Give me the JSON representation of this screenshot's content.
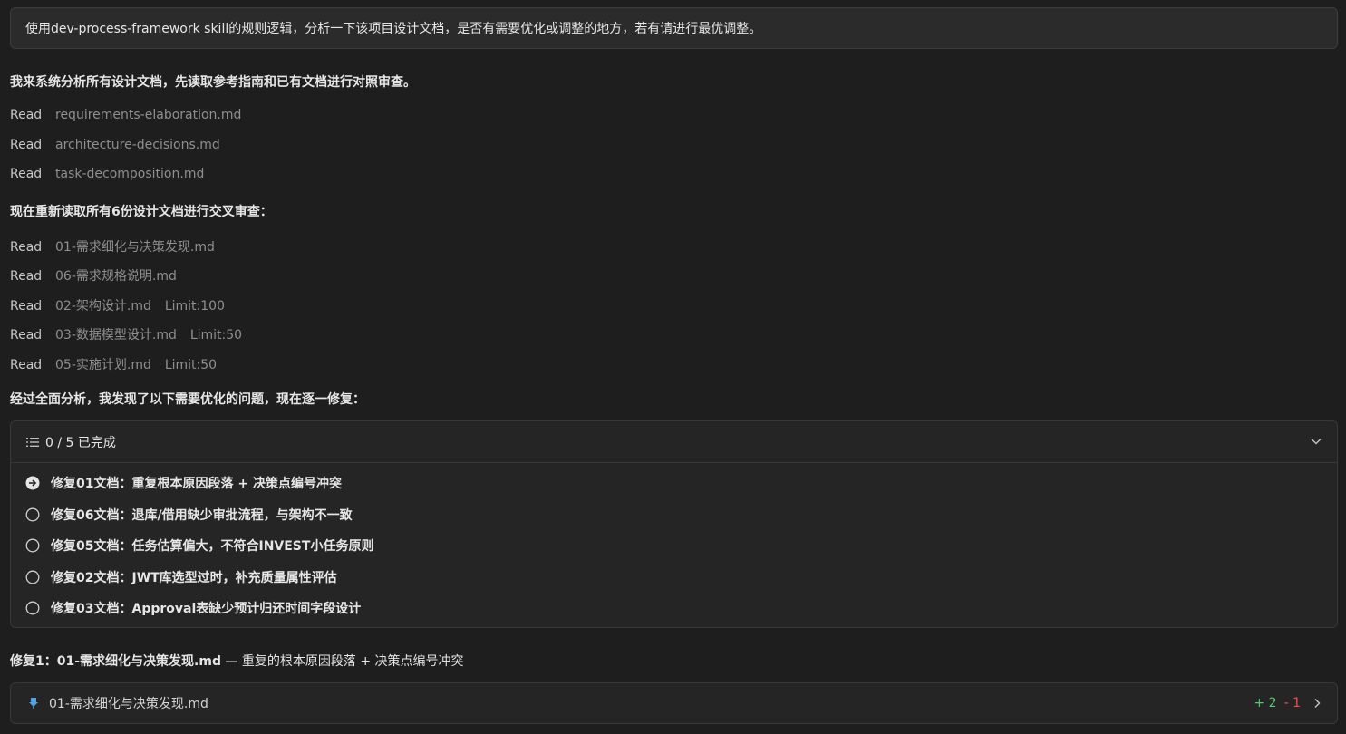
{
  "user_message": "使用dev-process-framework skill的规则逻辑，分析一下该项目设计文档，是否有需要优化或调整的地方，若有请进行最优调整。",
  "intro_heading": "我来系统分析所有设计文档，先读取参考指南和已有文档进行对照审查。",
  "reads_group1": [
    {
      "label": "Read",
      "file": "requirements-elaboration.md"
    },
    {
      "label": "Read",
      "file": "architecture-decisions.md"
    },
    {
      "label": "Read",
      "file": "task-decomposition.md"
    }
  ],
  "cross_review_heading": "现在重新读取所有6份设计文档进行交叉审查：",
  "reads_group2": [
    {
      "label": "Read",
      "file": "01-需求细化与决策发现.md",
      "limit": ""
    },
    {
      "label": "Read",
      "file": "06-需求规格说明.md",
      "limit": ""
    },
    {
      "label": "Read",
      "file": "02-架构设计.md",
      "limit": "Limit:100"
    },
    {
      "label": "Read",
      "file": "03-数据模型设计.md",
      "limit": "Limit:50"
    },
    {
      "label": "Read",
      "file": "05-实施计划.md",
      "limit": "Limit:50"
    }
  ],
  "analysis_heading": "经过全面分析，我发现了以下需要优化的问题，现在逐一修复：",
  "todo": {
    "progress_label": "0 / 5 已完成",
    "items": [
      {
        "text": "修复01文档：重复根本原因段落 + 决策点编号冲突",
        "status": "in-progress"
      },
      {
        "text": "修复06文档：退库/借用缺少审批流程，与架构不一致",
        "status": "pending"
      },
      {
        "text": "修复05文档：任务估算偏大，不符合INVEST小任务原则",
        "status": "pending"
      },
      {
        "text": "修复02文档：JWT库选型过时，补充质量属性评估",
        "status": "pending"
      },
      {
        "text": "修复03文档：Approval表缺少预计归还时间字段设计",
        "status": "pending"
      }
    ]
  },
  "fix_heading": {
    "strong": "修复1：01-需求细化与决策发现.md",
    "rest": " — 重复的根本原因段落 + 决策点编号冲突"
  },
  "file_edit": {
    "filename": "01-需求细化与决策发现.md",
    "added": "+ 2",
    "removed": "- 1"
  },
  "colors": {
    "background": "#1e1e1e",
    "card": "#252526",
    "added": "#4ec96b",
    "removed": "#f14c4c",
    "pin": "#4fa3e0"
  }
}
